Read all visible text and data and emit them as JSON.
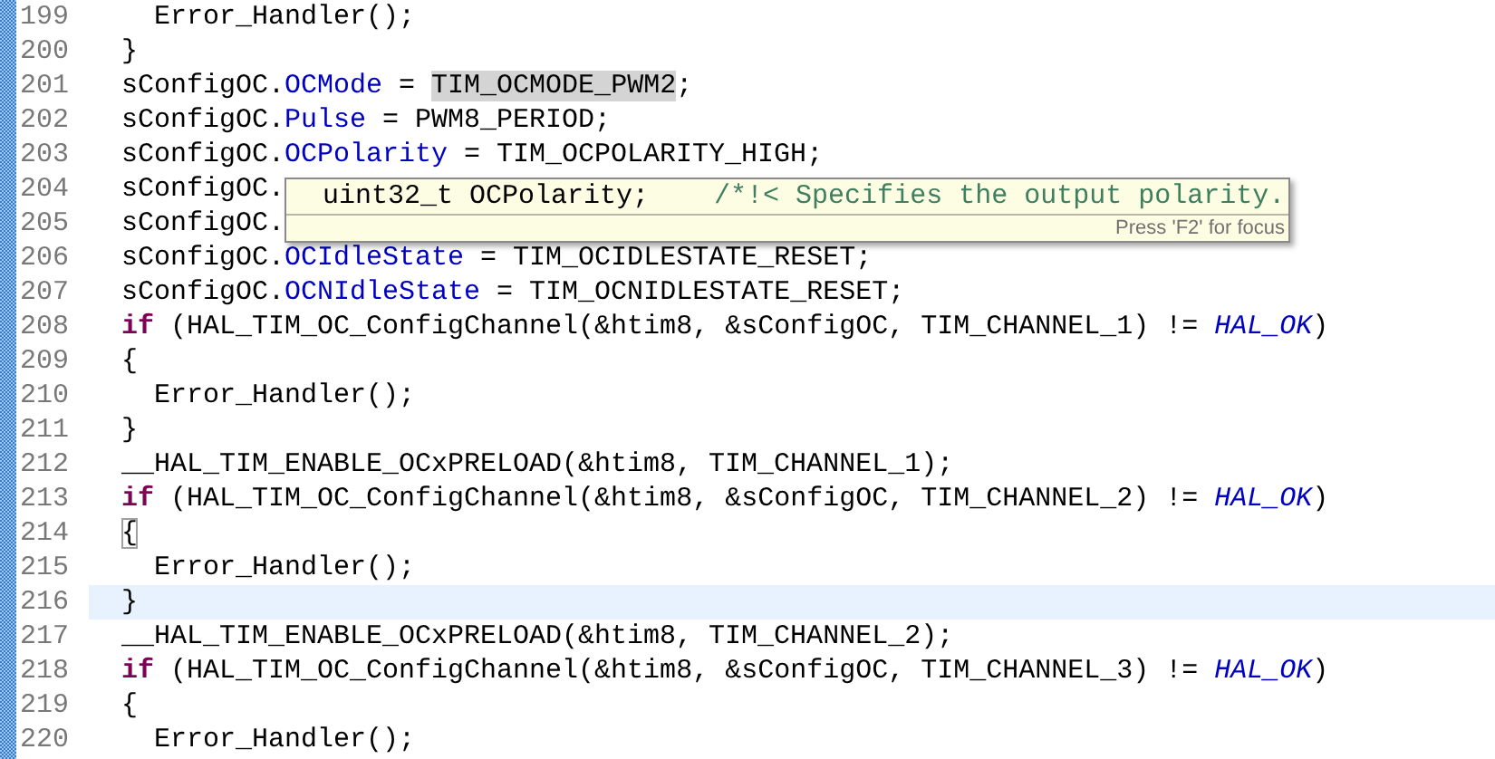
{
  "editor": {
    "lines": [
      {
        "number": "199",
        "current": false,
        "tokens": [
          {
            "kind": "plain",
            "text": "  Error_Handler();"
          }
        ]
      },
      {
        "number": "200",
        "current": false,
        "tokens": [
          {
            "kind": "plain",
            "text": "}"
          }
        ]
      },
      {
        "number": "201",
        "current": false,
        "tokens": [
          {
            "kind": "plain",
            "text": "sConfigOC."
          },
          {
            "kind": "field",
            "text": "OCMode"
          },
          {
            "kind": "plain",
            "text": " = "
          },
          {
            "kind": "occurrence",
            "text": "TIM_OCMODE_PWM2"
          },
          {
            "kind": "plain",
            "text": ";"
          }
        ]
      },
      {
        "number": "202",
        "current": false,
        "tokens": [
          {
            "kind": "plain",
            "text": "sConfigOC."
          },
          {
            "kind": "field",
            "text": "Pulse"
          },
          {
            "kind": "plain",
            "text": " = PWM8_PERIOD;"
          }
        ]
      },
      {
        "number": "203",
        "current": false,
        "tokens": [
          {
            "kind": "plain",
            "text": "sConfigOC."
          },
          {
            "kind": "field",
            "text": "OCPolarity"
          },
          {
            "kind": "plain",
            "text": " = TIM_OCPOLARITY_HIGH;"
          }
        ]
      },
      {
        "number": "204",
        "current": false,
        "tokens": [
          {
            "kind": "plain",
            "text": "sConfigOC."
          }
        ]
      },
      {
        "number": "205",
        "current": false,
        "tokens": [
          {
            "kind": "plain",
            "text": "sConfigOC."
          }
        ]
      },
      {
        "number": "206",
        "current": false,
        "tokens": [
          {
            "kind": "plain",
            "text": "sConfigOC."
          },
          {
            "kind": "field",
            "text": "OCIdleState"
          },
          {
            "kind": "plain",
            "text": " = TIM_OCIDLESTATE_RESET;"
          }
        ]
      },
      {
        "number": "207",
        "current": false,
        "tokens": [
          {
            "kind": "plain",
            "text": "sConfigOC."
          },
          {
            "kind": "field",
            "text": "OCNIdleState"
          },
          {
            "kind": "plain",
            "text": " = TIM_OCNIDLESTATE_RESET;"
          }
        ]
      },
      {
        "number": "208",
        "current": false,
        "tokens": [
          {
            "kind": "keyword",
            "text": "if"
          },
          {
            "kind": "plain",
            "text": " (HAL_TIM_OC_ConfigChannel(&htim8, &sConfigOC, TIM_CHANNEL_1) != "
          },
          {
            "kind": "enum",
            "text": "HAL_OK"
          },
          {
            "kind": "plain",
            "text": ")"
          }
        ]
      },
      {
        "number": "209",
        "current": false,
        "tokens": [
          {
            "kind": "plain",
            "text": "{"
          }
        ]
      },
      {
        "number": "210",
        "current": false,
        "tokens": [
          {
            "kind": "plain",
            "text": "  Error_Handler();"
          }
        ]
      },
      {
        "number": "211",
        "current": false,
        "tokens": [
          {
            "kind": "plain",
            "text": "}"
          }
        ]
      },
      {
        "number": "212",
        "current": false,
        "tokens": [
          {
            "kind": "plain",
            "text": "__HAL_TIM_ENABLE_OCxPRELOAD(&htim8, TIM_CHANNEL_1);"
          }
        ]
      },
      {
        "number": "213",
        "current": false,
        "tokens": [
          {
            "kind": "keyword",
            "text": "if"
          },
          {
            "kind": "plain",
            "text": " (HAL_TIM_OC_ConfigChannel(&htim8, &sConfigOC, TIM_CHANNEL_2) != "
          },
          {
            "kind": "enum",
            "text": "HAL_OK"
          },
          {
            "kind": "plain",
            "text": ")"
          }
        ]
      },
      {
        "number": "214",
        "current": false,
        "tokens": [
          {
            "kind": "bracket_match",
            "text": "{"
          }
        ]
      },
      {
        "number": "215",
        "current": false,
        "tokens": [
          {
            "kind": "plain",
            "text": "  Error_Handler();"
          }
        ]
      },
      {
        "number": "216",
        "current": true,
        "tokens": [
          {
            "kind": "plain",
            "text": "}"
          }
        ]
      },
      {
        "number": "217",
        "current": false,
        "tokens": [
          {
            "kind": "plain",
            "text": "__HAL_TIM_ENABLE_OCxPRELOAD(&htim8, TIM_CHANNEL_2);"
          }
        ]
      },
      {
        "number": "218",
        "current": false,
        "tokens": [
          {
            "kind": "keyword",
            "text": "if"
          },
          {
            "kind": "plain",
            "text": " (HAL_TIM_OC_ConfigChannel(&htim8, &sConfigOC, TIM_CHANNEL_3) != "
          },
          {
            "kind": "enum",
            "text": "HAL_OK"
          },
          {
            "kind": "plain",
            "text": ")"
          }
        ]
      },
      {
        "number": "219",
        "current": false,
        "tokens": [
          {
            "kind": "plain",
            "text": "{"
          }
        ]
      },
      {
        "number": "220",
        "current": false,
        "tokens": [
          {
            "kind": "plain",
            "text": "  Error_Handler();"
          }
        ]
      }
    ]
  },
  "hover": {
    "signature": "uint32_t OCPolarity;",
    "comment": "/*!< Specifies the output polarity.",
    "hint": "Press 'F2' for focus"
  }
}
